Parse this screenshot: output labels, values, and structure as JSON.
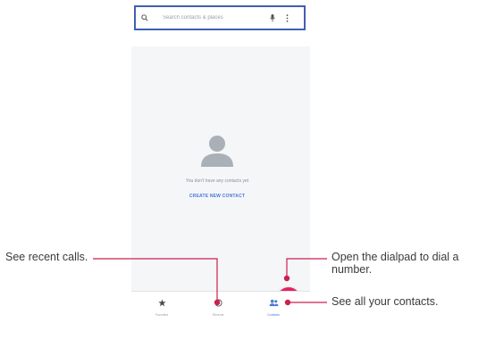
{
  "search": {
    "placeholder": "Search contacts & places"
  },
  "empty_state": {
    "message": "You don't have any contacts yet",
    "create_link": "CREATE NEW CONTACT"
  },
  "bottom_nav": {
    "items": [
      {
        "label": "Favorites",
        "icon": "star-icon"
      },
      {
        "label": "Recents",
        "icon": "clock-icon"
      },
      {
        "label": "Contacts",
        "icon": "people-icon",
        "active": true
      }
    ]
  },
  "fab": {
    "icon": "dialpad-icon"
  },
  "callouts": {
    "recent_calls": "See recent calls.",
    "dialpad_line1": "Open the dialpad to dial a",
    "dialpad_line2": "number.",
    "contacts": "See all your contacts."
  },
  "colors": {
    "accent_blue": "#3f5fb2",
    "fab_pink": "#e91e63",
    "callout_red": "#cf1f4f"
  }
}
